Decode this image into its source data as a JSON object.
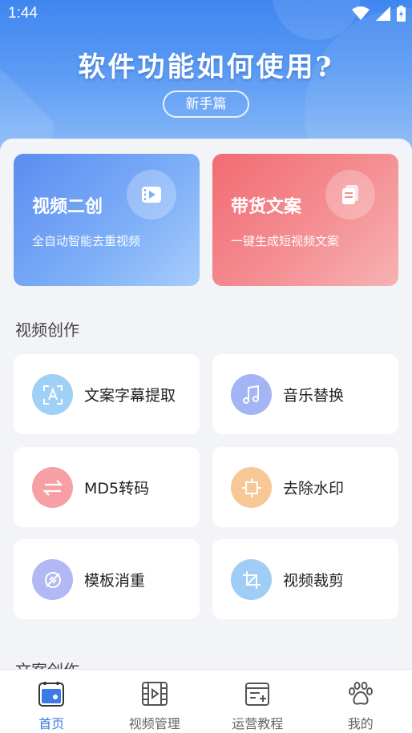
{
  "status_bar": {
    "time": "1:44"
  },
  "hero": {
    "title": "软件功能如何使用?",
    "pill_label": "新手篇"
  },
  "feature_cards": [
    {
      "title": "视频二创",
      "subtitle": "全自动智能去重视频",
      "icon": "video-icon"
    },
    {
      "title": "带货文案",
      "subtitle": "一键生成短视频文案",
      "icon": "document-icon"
    }
  ],
  "section_video": {
    "title": "视频创作",
    "tools": [
      {
        "label": "文案字幕提取",
        "icon": "text-scan-icon",
        "color": "#9fd0f6"
      },
      {
        "label": "音乐替换",
        "icon": "music-note-icon",
        "color": "#a5b4f4"
      },
      {
        "label": "MD5转码",
        "icon": "swap-arrows-icon",
        "color": "#f6a0a6"
      },
      {
        "label": "去除水印",
        "icon": "crop-target-icon",
        "color": "#f7c896"
      },
      {
        "label": "模板消重",
        "icon": "no-copy-icon",
        "color": "#b1b8f4"
      },
      {
        "label": "视频裁剪",
        "icon": "crop-icon",
        "color": "#9fcdf6"
      }
    ]
  },
  "section_copy": {
    "title": "文案创作"
  },
  "bottom_nav": [
    {
      "label": "首页",
      "icon": "home-icon",
      "active": true
    },
    {
      "label": "视频管理",
      "icon": "film-icon",
      "active": false
    },
    {
      "label": "运营教程",
      "icon": "tutorial-icon",
      "active": false
    },
    {
      "label": "我的",
      "icon": "paw-icon",
      "active": false
    }
  ],
  "colors": {
    "accent": "#3b7be8",
    "hero_top": "#3f86f0"
  }
}
